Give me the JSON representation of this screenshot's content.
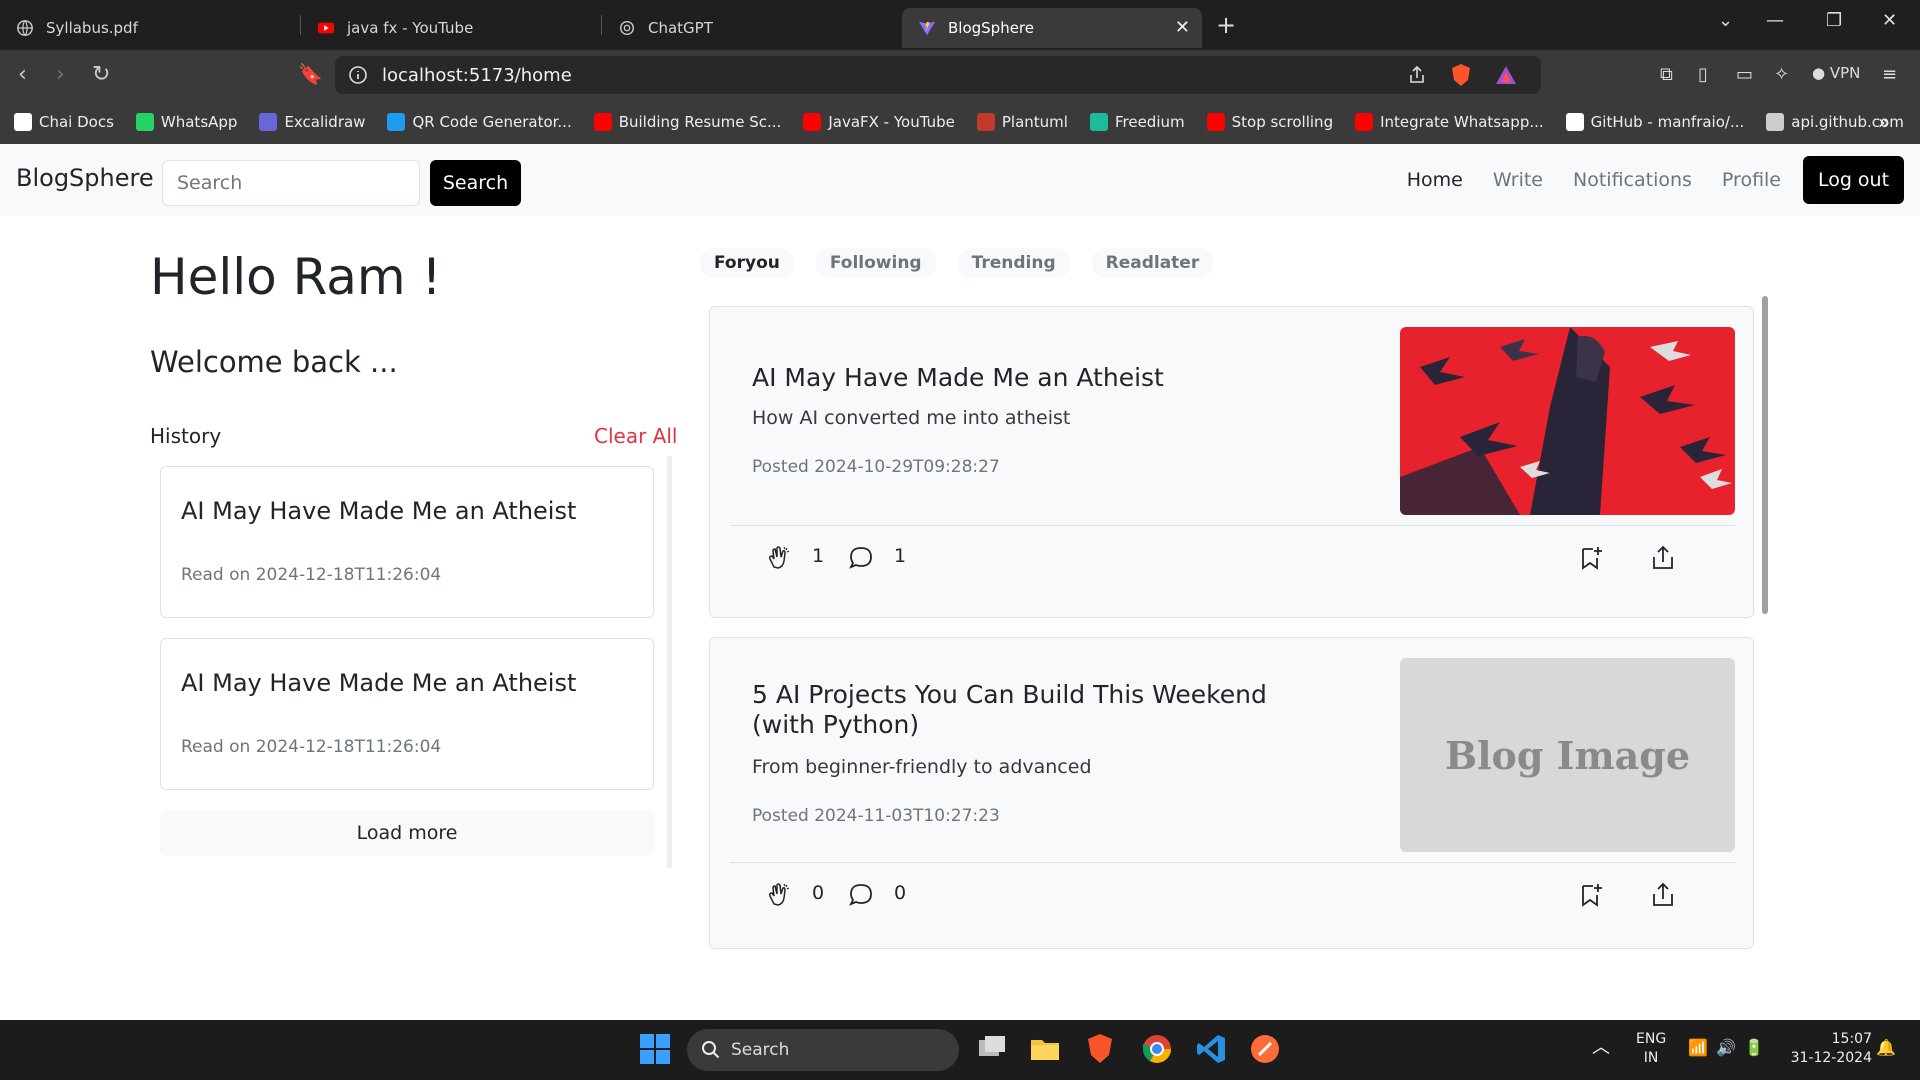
{
  "browser": {
    "tabs": [
      {
        "title": "Syllabus.pdf",
        "icon": "globe-icon"
      },
      {
        "title": "java fx - YouTube",
        "icon": "youtube-icon"
      },
      {
        "title": "ChatGPT",
        "icon": "chatgpt-icon"
      },
      {
        "title": "BlogSphere",
        "icon": "vite-icon",
        "active": true
      }
    ],
    "url": "localhost:5173/home",
    "vpn_label": "VPN",
    "bookmarks": [
      {
        "label": "Chai Docs",
        "color": "#ffffff"
      },
      {
        "label": "WhatsApp",
        "color": "#25d366"
      },
      {
        "label": "Excalidraw",
        "color": "#6965db"
      },
      {
        "label": "QR Code Generator...",
        "color": "#1e9bf0"
      },
      {
        "label": "Building Resume Sc...",
        "color": "#ff0000"
      },
      {
        "label": "JavaFX - YouTube",
        "color": "#ff0000"
      },
      {
        "label": "Plantuml",
        "color": "#c0392b"
      },
      {
        "label": "Freedium",
        "color": "#1abc9c"
      },
      {
        "label": "Stop scrolling",
        "color": "#ff0000"
      },
      {
        "label": "Integrate Whatsapp...",
        "color": "#ff0000"
      },
      {
        "label": "GitHub - manfraio/...",
        "color": "#ffffff"
      },
      {
        "label": "api.github.com",
        "color": "#cccccc"
      }
    ]
  },
  "app": {
    "brand": "BlogSphere",
    "search_placeholder": "Search",
    "search_button": "Search",
    "nav": {
      "home": "Home",
      "write": "Write",
      "notifications": "Notifications",
      "profile": "Profile",
      "logout": "Log out"
    }
  },
  "left": {
    "hello": "Hello Ram !",
    "welcome": "Welcome back ...",
    "history_label": "History",
    "clear_all": "Clear All",
    "history": [
      {
        "title": "AI May Have Made Me an Atheist",
        "read": "Read on 2024-12-18T11:26:04"
      },
      {
        "title": "AI May Have Made Me an Atheist",
        "read": "Read on 2024-12-18T11:26:04"
      }
    ],
    "load_more": "Load more"
  },
  "feed": {
    "tabs": [
      "Foryou",
      "Following",
      "Trending",
      "Readlater"
    ],
    "posts": [
      {
        "title": "AI May Have Made Me an Atheist",
        "subtitle": "How AI converted me into atheist",
        "posted": "Posted 2024-10-29T09:28:27",
        "claps": "1",
        "comments": "1",
        "image": "red-crows-artwork"
      },
      {
        "title": "5 AI Projects You Can Build This Weekend (with Python)",
        "subtitle": "From beginner-friendly to advanced",
        "posted": "Posted 2024-11-03T10:27:23",
        "claps": "0",
        "comments": "0",
        "image_placeholder": "Blog Image"
      }
    ]
  },
  "taskbar": {
    "search": "Search",
    "lang_top": "ENG",
    "lang_bottom": "IN",
    "time": "15:07",
    "date": "31-12-2024"
  },
  "colors": {
    "accent_danger": "#dc3545",
    "primary_black": "#000000"
  }
}
